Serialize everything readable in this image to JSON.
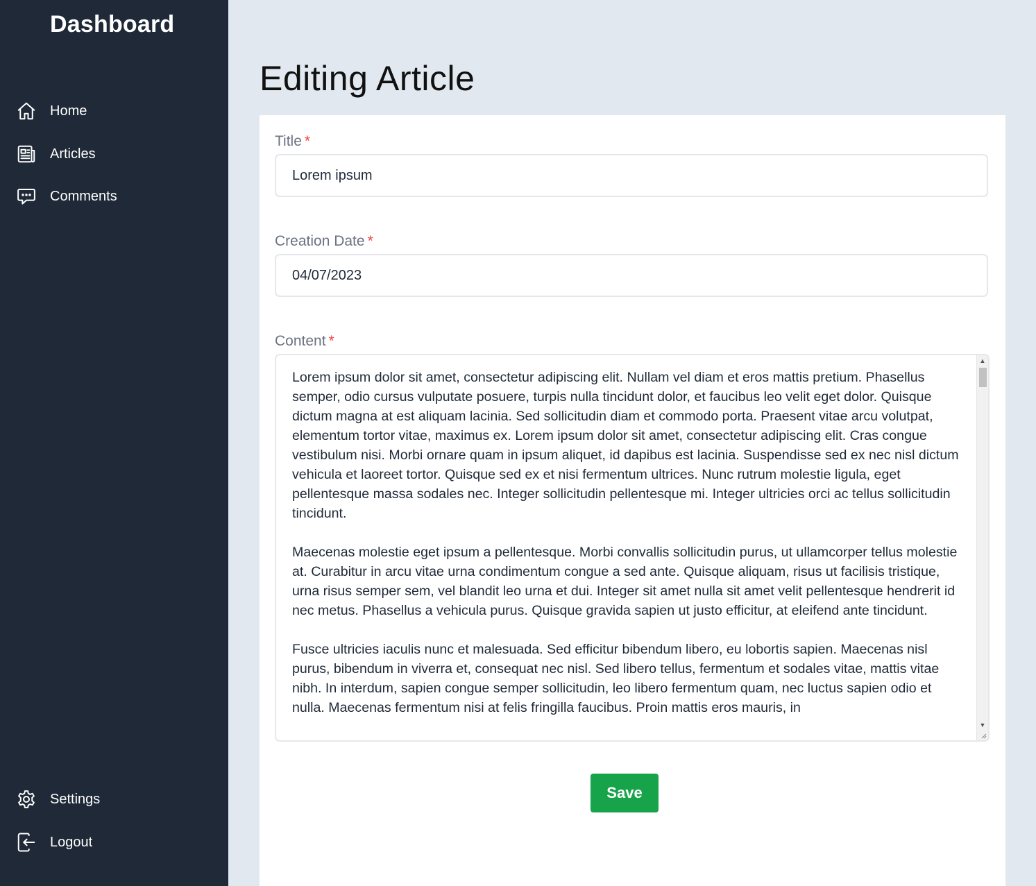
{
  "sidebar": {
    "brand": "Dashboard",
    "items": [
      {
        "label": "Home",
        "icon": "home-icon"
      },
      {
        "label": "Articles",
        "icon": "newspaper-icon"
      },
      {
        "label": "Comments",
        "icon": "chat-bubble-icon"
      }
    ],
    "bottom_items": [
      {
        "label": "Settings",
        "icon": "gear-icon"
      },
      {
        "label": "Logout",
        "icon": "logout-icon"
      }
    ]
  },
  "page": {
    "title": "Editing Article"
  },
  "form": {
    "title_label": "Title",
    "title_value": "Lorem ipsum",
    "date_label": "Creation Date",
    "date_value": "04/07/2023",
    "content_label": "Content",
    "required_marker": "*",
    "content_paragraphs": [
      "Lorem ipsum dolor sit amet, consectetur adipiscing elit. Nullam vel diam et eros mattis pretium. Phasellus semper, odio cursus vulputate posuere, turpis nulla tincidunt dolor, et faucibus leo velit eget dolor. Quisque dictum magna at est aliquam lacinia. Sed sollicitudin diam et commodo porta. Praesent vitae arcu volutpat, elementum tortor vitae, maximus ex. Lorem ipsum dolor sit amet, consectetur adipiscing elit. Cras congue vestibulum nisi. Morbi ornare quam in ipsum aliquet, id dapibus est lacinia. Suspendisse sed ex nec nisl dictum vehicula et laoreet tortor. Quisque sed ex et nisi fermentum ultrices. Nunc rutrum molestie ligula, eget pellentesque massa sodales nec. Integer sollicitudin pellentesque mi. Integer ultricies orci ac tellus sollicitudin tincidunt.",
      "Maecenas molestie eget ipsum a pellentesque. Morbi convallis sollicitudin purus, ut ullamcorper tellus molestie at. Curabitur in arcu vitae urna condimentum congue a sed ante. Quisque aliquam, risus ut facilisis tristique, urna risus semper sem, vel blandit leo urna et dui. Integer sit amet nulla sit amet velit pellentesque hendrerit id nec metus. Phasellus a vehicula purus. Quisque gravida sapien ut justo efficitur, at eleifend ante tincidunt.",
      "Fusce ultricies iaculis nunc et malesuada. Sed efficitur bibendum libero, eu lobortis sapien. Maecenas nisl purus, bibendum in viverra et, consequat nec nisl. Sed libero tellus, fermentum et sodales vitae, mattis vitae nibh. In interdum, sapien congue semper sollicitudin, leo libero fermentum quam, nec luctus sapien odio et nulla. Maecenas fermentum nisi at felis fringilla faucibus. Proin mattis eros mauris, in"
    ],
    "save_label": "Save"
  },
  "colors": {
    "sidebar_bg": "#1f2937",
    "page_bg": "#e2e8f0",
    "required": "#ef4444",
    "save_button": "#16a34a"
  }
}
